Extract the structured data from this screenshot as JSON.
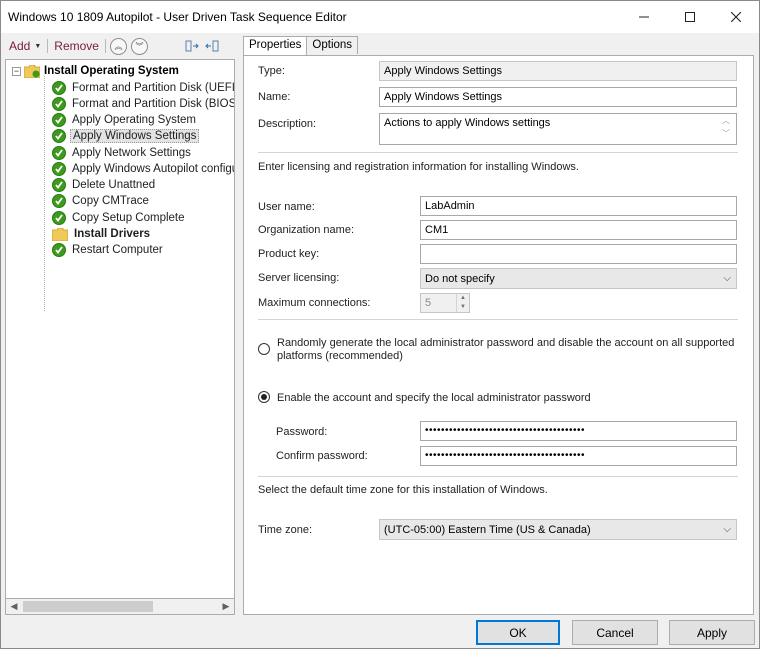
{
  "window": {
    "title": "Windows 10 1809 Autopilot - User Driven Task Sequence Editor",
    "controls": [
      "minimize-icon",
      "maximize-icon",
      "close-icon"
    ]
  },
  "toolbar": {
    "add_label": "Add",
    "remove_label": "Remove"
  },
  "tree": {
    "root_label": "Install Operating System",
    "items": [
      {
        "label": "Format and Partition Disk (UEFI)",
        "icon": "check-icon",
        "bold": false
      },
      {
        "label": "Format and Partition Disk (BIOS)",
        "icon": "check-icon",
        "bold": false
      },
      {
        "label": "Apply Operating System",
        "icon": "check-icon",
        "bold": false
      },
      {
        "label": "Apply Windows Settings",
        "icon": "check-icon",
        "bold": false,
        "selected": true
      },
      {
        "label": "Apply Network Settings",
        "icon": "check-icon",
        "bold": false
      },
      {
        "label": "Apply Windows Autopilot configur",
        "icon": "check-icon",
        "bold": false
      },
      {
        "label": "Delete Unattned",
        "icon": "check-icon",
        "bold": false
      },
      {
        "label": "Copy CMTrace",
        "icon": "check-icon",
        "bold": false
      },
      {
        "label": "Copy Setup Complete",
        "icon": "check-icon",
        "bold": false
      },
      {
        "label": "Install Drivers",
        "icon": "folder-icon",
        "bold": true
      },
      {
        "label": "Restart Computer",
        "icon": "check-icon",
        "bold": false
      }
    ]
  },
  "tabs": [
    {
      "label": "Properties",
      "active": true
    },
    {
      "label": "Options",
      "active": false
    }
  ],
  "properties": {
    "type_label": "Type:",
    "type_value": "Apply Windows Settings",
    "name_label": "Name:",
    "name_value": "Apply Windows Settings",
    "description_label": "Description:",
    "description_value": "Actions to apply Windows settings",
    "licensing_intro": "Enter licensing and registration information for installing Windows.",
    "user_name_label": "User name:",
    "user_name_value": "LabAdmin",
    "org_name_label": "Organization name:",
    "org_name_value": "CM1",
    "product_key_label": "Product key:",
    "product_key_value": "",
    "server_licensing_label": "Server licensing:",
    "server_licensing_value": "Do not specify",
    "max_connections_label": "Maximum connections:",
    "max_connections_value": "5",
    "radio_random_label": "Randomly generate the local administrator password and disable the account on all supported platforms (recommended)",
    "radio_random_checked": false,
    "radio_enable_label": "Enable the account and specify the local administrator password",
    "radio_enable_checked": true,
    "password_label": "Password:",
    "password_value": "••••••••••••••••••••••••••••••••••••••••",
    "confirm_password_label": "Confirm password:",
    "confirm_password_value": "••••••••••••••••••••••••••••••••••••••••",
    "timezone_intro": "Select the default time zone for this installation of Windows.",
    "timezone_label": "Time zone:",
    "timezone_value": "(UTC-05:00) Eastern Time (US & Canada)"
  },
  "buttons": {
    "ok": "OK",
    "cancel": "Cancel",
    "apply": "Apply"
  },
  "colors": {
    "accent": "#0078d7",
    "toolbar_text": "#7a1b3c",
    "success_green": "#3c9a1e"
  }
}
